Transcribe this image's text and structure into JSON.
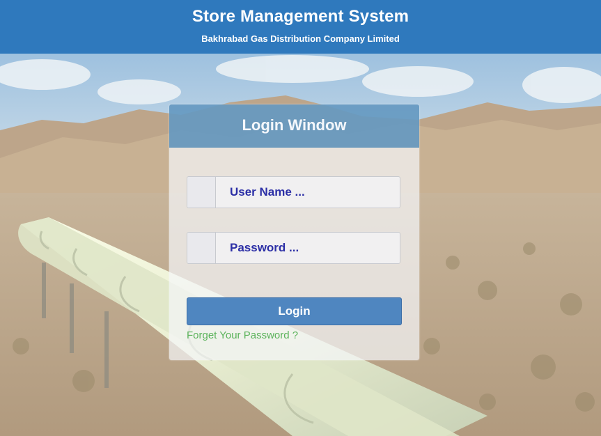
{
  "header": {
    "title": "Store Management System",
    "subtitle": "Bakhrabad Gas Distribution Company Limited"
  },
  "login": {
    "window_title": "Login Window",
    "username_placeholder": "User Name ...",
    "password_placeholder": "Password ...",
    "login_label": "Login",
    "forgot_label": "Forget Your Password ?"
  },
  "colors": {
    "header_bg": "#2f79bd",
    "panel_head_bg": "#3e80b1",
    "button_bg": "#4f86c0",
    "input_text": "#2c2fa6",
    "forgot_link": "#5bb35b"
  }
}
